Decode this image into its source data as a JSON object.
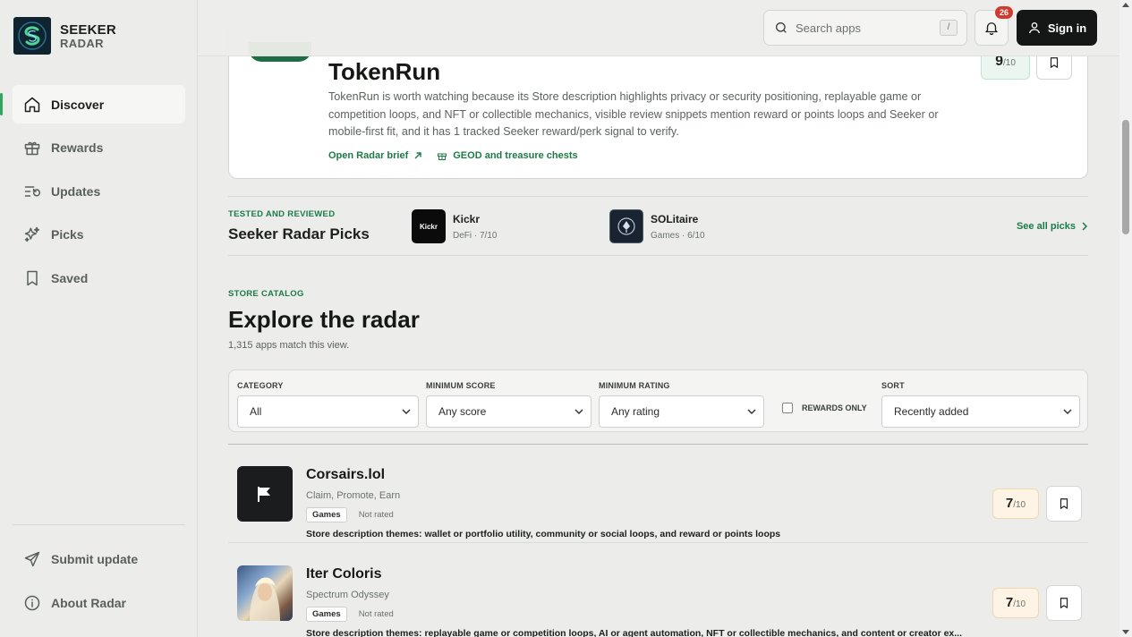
{
  "brand": {
    "line1": "SEEKER",
    "line2": "RADAR"
  },
  "sidebar": {
    "items": [
      {
        "label": "Discover",
        "icon": "home-icon",
        "active": true
      },
      {
        "label": "Rewards",
        "icon": "gift-icon"
      },
      {
        "label": "Updates",
        "icon": "updates-icon"
      },
      {
        "label": "Picks",
        "icon": "sparkles-icon"
      },
      {
        "label": "Saved",
        "icon": "bookmark-icon"
      }
    ],
    "footer": [
      {
        "label": "Submit update",
        "icon": "send-icon"
      },
      {
        "label": "About Radar",
        "icon": "info-icon"
      }
    ]
  },
  "topbar": {
    "search_placeholder": "Search apps",
    "search_shortcut": "/",
    "notification_count": "26",
    "signin_label": "Sign in"
  },
  "feature": {
    "title": "TokenRun",
    "description": "TokenRun is worth watching because its Store description highlights privacy or security positioning, replayable game or competition loops, and NFT or collectible mechanics, visible review snippets mention reward or points loops and Seeker or mobile-first fit, and it has 1 tracked Seeker reward/perk signal to verify.",
    "link_brief": "Open Radar brief",
    "link_reward": "GEOD and treasure chests",
    "score": "9",
    "score_max": "/10"
  },
  "picks": {
    "eyebrow": "TESTED AND REVIEWED",
    "title": "Seeker Radar Picks",
    "items": [
      {
        "name": "Kickr",
        "meta": "DeFi · 7/10",
        "icon_text": "Kickr"
      },
      {
        "name": "SOLitaire",
        "meta": "Games · 6/10"
      }
    ],
    "see_all": "See all picks"
  },
  "explore": {
    "eyebrow": "STORE CATALOG",
    "title": "Explore the radar",
    "count": "1,315 apps match this view."
  },
  "filters": {
    "category": {
      "label": "CATEGORY",
      "value": "All"
    },
    "min_score": {
      "label": "MINIMUM SCORE",
      "value": "Any score"
    },
    "min_rating": {
      "label": "MINIMUM RATING",
      "value": "Any rating"
    },
    "rewards_only": {
      "label": "REWARDS ONLY",
      "checked": false
    },
    "sort": {
      "label": "SORT",
      "value": "Recently added"
    }
  },
  "apps": [
    {
      "name": "Corsairs.lol",
      "subtitle": "Claim, Promote, Earn",
      "category": "Games",
      "rating": "Not rated",
      "description": "Store description themes: wallet or portfolio utility, community or social loops, and reward or points loops",
      "score": "7",
      "score_max": "/10"
    },
    {
      "name": "Iter Coloris",
      "subtitle": "Spectrum Odyssey",
      "category": "Games",
      "rating": "Not rated",
      "description": "Store description themes: replayable game or competition loops, AI or agent automation, NFT or collectible mechanics, and content or creator ex...",
      "score": "7",
      "score_max": "/10"
    }
  ],
  "colors": {
    "accent": "#1c7a47",
    "active_bar": "#2fa55e",
    "badge": "#d13a2f"
  }
}
